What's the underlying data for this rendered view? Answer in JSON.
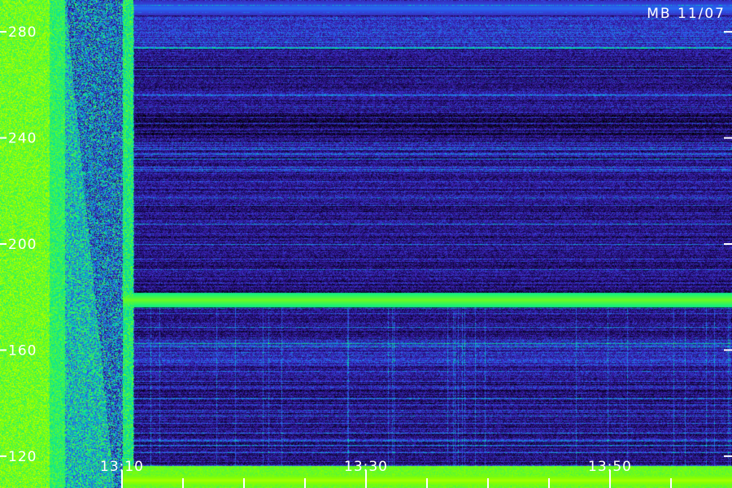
{
  "station_label": "MB 11/07",
  "chart_data": {
    "type": "heatmap",
    "title": "",
    "xlabel": "",
    "ylabel": "",
    "y_ticks": [
      120,
      160,
      200,
      240,
      280
    ],
    "x_ticks": [
      "13:10",
      "13:30",
      "13:50"
    ],
    "x_minor_tick_count": 10,
    "ylim": [
      108,
      292
    ],
    "colormap": [
      "#000000",
      "#1a0a5a",
      "#3a1fb0",
      "#2a5ef0",
      "#00c8c0",
      "#18f07a",
      "#88ff00",
      "#e8ff00"
    ],
    "bands": [
      {
        "name": "",
        "y": 179,
        "intensity": 0.82
      },
      {
        "name": "",
        "y": 111,
        "intensity": 0.9
      },
      {
        "name": "",
        "y": 289,
        "intensity": 0.45
      }
    ]
  }
}
